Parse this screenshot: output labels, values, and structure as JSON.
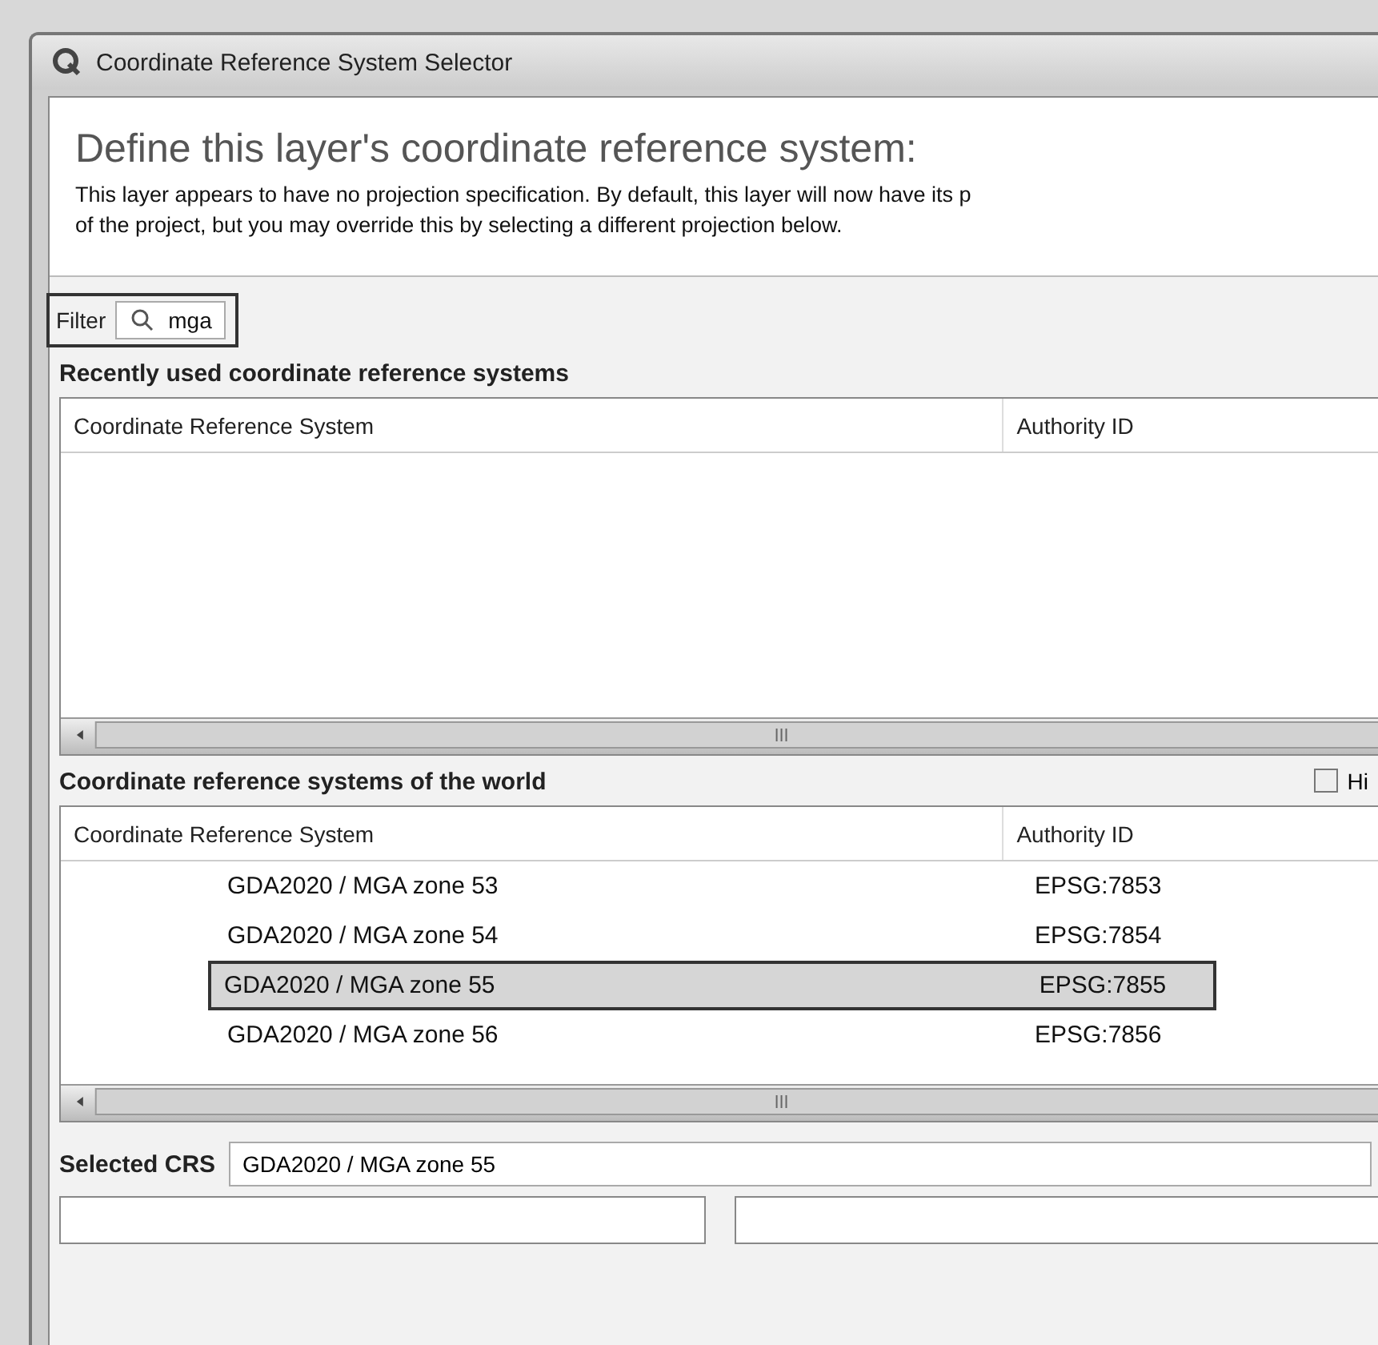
{
  "window": {
    "title": "Coordinate Reference System Selector"
  },
  "heading": "Define this layer's coordinate reference system:",
  "description": "This layer appears to have no projection specification. By default, this layer will now have its p\nof the project, but you may override this by selecting a different projection below.",
  "filter": {
    "label": "Filter",
    "value": "mga"
  },
  "recent": {
    "title": "Recently used coordinate reference systems",
    "columns": [
      "Coordinate Reference System",
      "Authority ID"
    ]
  },
  "world": {
    "title": "Coordinate reference systems of the world",
    "hide_checkbox": {
      "label": "Hi",
      "checked": false
    },
    "columns": [
      "Coordinate Reference System",
      "Authority ID"
    ],
    "rows": [
      {
        "name": "GDA2020 / MGA zone 53",
        "id": "EPSG:7853",
        "selected": false
      },
      {
        "name": "GDA2020 / MGA zone 54",
        "id": "EPSG:7854",
        "selected": false
      },
      {
        "name": "GDA2020 / MGA zone 55",
        "id": "EPSG:7855",
        "selected": true
      },
      {
        "name": "GDA2020 / MGA zone 56",
        "id": "EPSG:7856",
        "selected": false
      }
    ]
  },
  "selected_crs": {
    "label": "Selected CRS",
    "value": "GDA2020 / MGA zone 55"
  }
}
